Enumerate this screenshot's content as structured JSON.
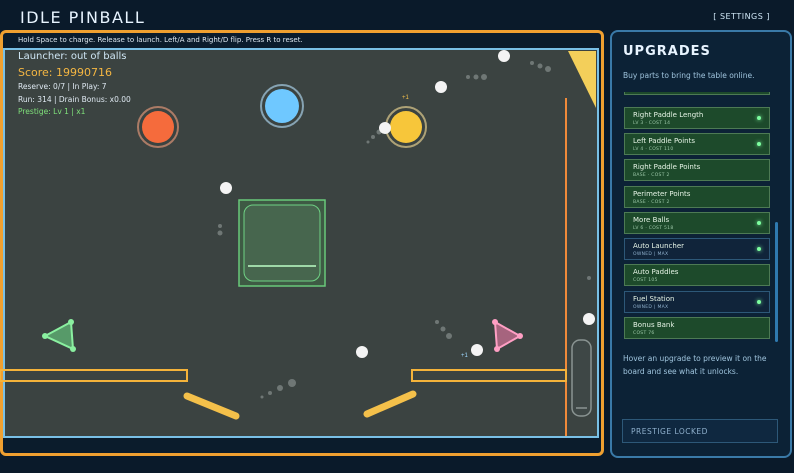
{
  "app": {
    "title": "IDLE PINBALL",
    "settings_label": "[ SETTINGS ]"
  },
  "board": {
    "hint": "Hold Space to charge. Release to launch. Left/A and Right/D flip. Press R to reset.",
    "stats": {
      "launcher": "Launcher: out of balls",
      "score": "Score: 19990716",
      "reserve": "Reserve: 0/7 | In Play: 7",
      "run": "Run: 314 | Drain Bonus: x0.00",
      "prestige": "Prestige: Lv 1 | x1"
    },
    "popups": [
      "+1",
      "+1"
    ],
    "colors": {
      "table": "#3b4341",
      "frame": "#f0a030",
      "rail": "#79c0e6",
      "flipper": "#f4c04a",
      "bumper_orange": "#f56b3c",
      "bumper_blue": "#6fc8ff",
      "bumper_yellow": "#f7c63a",
      "slingshot_green": "#6fe28a",
      "slingshot_pink": "#ff7fb0"
    }
  },
  "upgrades": {
    "title": "UPGRADES",
    "subtitle": "Buy parts to bring the table online.",
    "items": [
      {
        "name": "Right Paddle Length",
        "meta": "LV 3 · COST 14",
        "owned": false,
        "dot": true
      },
      {
        "name": "Left Paddle Points",
        "meta": "LV 4 · COST 110",
        "owned": false,
        "dot": true
      },
      {
        "name": "Right Paddle Points",
        "meta": "BASE · COST 2",
        "owned": false,
        "dot": false
      },
      {
        "name": "Perimeter Points",
        "meta": "BASE · COST 2",
        "owned": false,
        "dot": false
      },
      {
        "name": "More Balls",
        "meta": "LV 6 · COST 518",
        "owned": false,
        "dot": true
      },
      {
        "name": "Auto Launcher",
        "meta": "OWNED | MAX",
        "owned": true,
        "dot": true
      },
      {
        "name": "Auto Paddles",
        "meta": "COST 105",
        "owned": false,
        "dot": false
      },
      {
        "name": "Fuel Station",
        "meta": "OWNED | MAX",
        "owned": true,
        "dot": true
      },
      {
        "name": "Bonus Bank",
        "meta": "COST 76",
        "owned": false,
        "dot": false
      }
    ],
    "hover_note": "Hover an upgrade to preview it on the board and see what it unlocks.",
    "prestige_button": "PRESTIGE LOCKED"
  }
}
